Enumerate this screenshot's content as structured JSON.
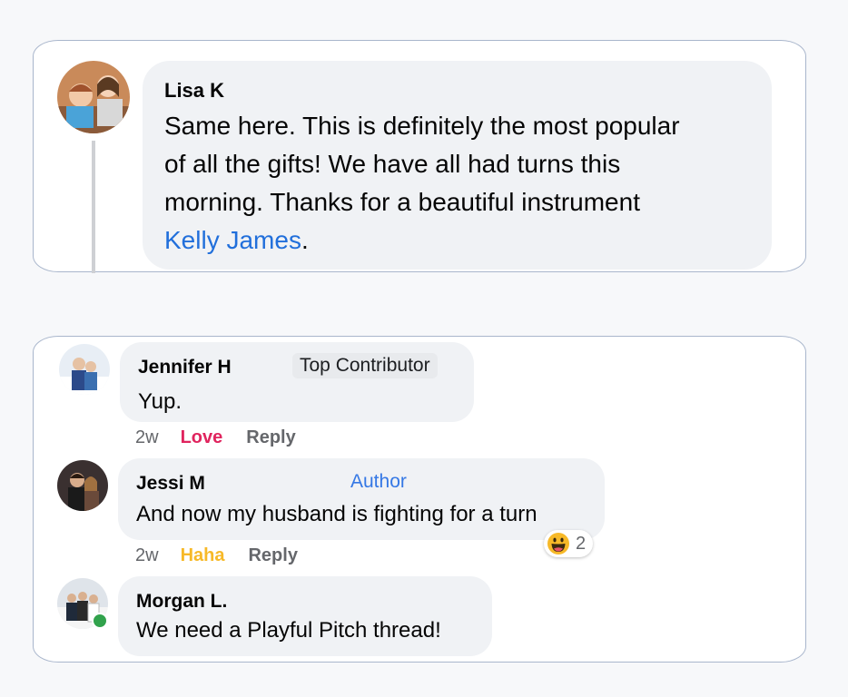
{
  "comments": [
    {
      "name": "Lisa K",
      "text_lines": [
        "Same here. This is definitely the most popular",
        "of all the gifts! We have all had turns this",
        "morning. Thanks for a beautiful instrument"
      ],
      "mention": "Kelly James",
      "mention_suffix": "."
    },
    {
      "name": "Jennifer H",
      "badge": "Top Contributor",
      "text": "Yup.",
      "time": "2w",
      "reaction_action": "Love",
      "reaction_color": "#e0245e",
      "reply": "Reply"
    },
    {
      "name": "Jessi M",
      "badge": "Author",
      "text": "And now my husband is fighting for a turn",
      "time": "2w",
      "reaction_action": "Haha",
      "reaction_color": "#f7b928",
      "reply": "Reply",
      "reaction_icon": "grinning-face-icon",
      "reaction_count": "2"
    },
    {
      "name": "Morgan L.",
      "text": "We need a Playful Pitch thread!",
      "online": true
    }
  ],
  "colors": {
    "link": "#216fdb",
    "bubble": "#f0f2f5",
    "card_border": "#a9b6cc",
    "online": "#31a24c"
  }
}
